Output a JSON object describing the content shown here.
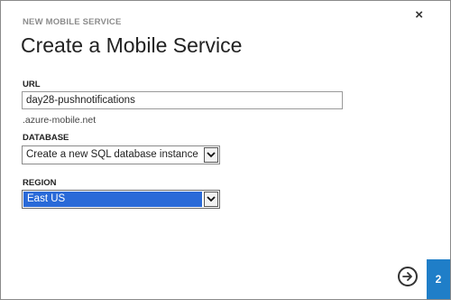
{
  "dialog": {
    "kicker": "NEW MOBILE SERVICE",
    "title": "Create a Mobile Service",
    "close_glyph": "×"
  },
  "url_field": {
    "label": "URL",
    "value": "day28-pushnotifications",
    "suffix": ".azure-mobile.net"
  },
  "database_field": {
    "label": "DATABASE",
    "selected": "Create a new SQL database instance"
  },
  "region_field": {
    "label": "REGION",
    "selected": "East US"
  },
  "footer": {
    "step_number": "2"
  },
  "colors": {
    "accent": "#1f7ec8",
    "selection": "#2a6ad8"
  }
}
